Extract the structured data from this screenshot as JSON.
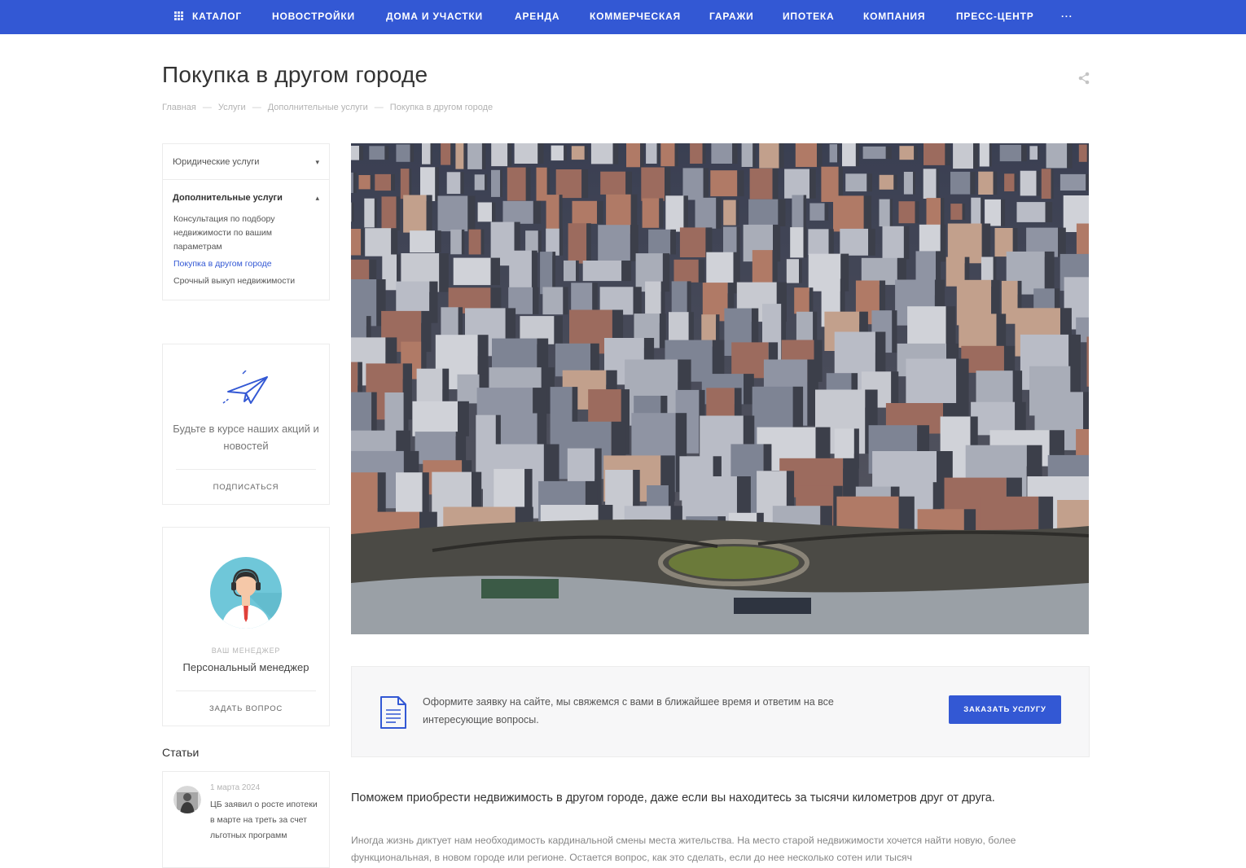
{
  "nav": {
    "items": [
      "КАТАЛОГ",
      "НОВОСТРОЙКИ",
      "ДОМА И УЧАСТКИ",
      "АРЕНДА",
      "КОММЕРЧЕСКАЯ",
      "ГАРАЖИ",
      "ИПОТЕКА",
      "КОМПАНИЯ",
      "ПРЕСС-ЦЕНТР",
      "···"
    ],
    "catalog_icon": "grid-icon"
  },
  "page": {
    "title": "Покупка в другом городе",
    "share_icon": "share-icon"
  },
  "breadcrumb": [
    "Главная",
    "Услуги",
    "Дополнительные услуги",
    "Покупка в другом городе"
  ],
  "breadcrumb_sep": "—",
  "sidebar": {
    "legal": {
      "label": "Юридические услуги",
      "caret": "▾"
    },
    "extra": {
      "label": "Дополнительные услуги",
      "caret": "▴",
      "items": [
        "Консультация по подбору недвижимости по вашим параметрам",
        "Покупка в другом городе",
        "Срочный выкуп недвижимости"
      ],
      "active_index": 1
    }
  },
  "subscribe": {
    "icon": "paper-plane-icon",
    "text": "Будьте в курсе наших акций и новостей",
    "link": "ПОДПИСАТЬСЯ"
  },
  "manager": {
    "icon": "manager-avatar",
    "caption": "ВАШ МЕНЕДЖЕР",
    "name": "Персональный менеджер",
    "link": "ЗАДАТЬ ВОПРОС"
  },
  "articles": {
    "title": "Статьи",
    "items": [
      {
        "date": "1 марта 2024",
        "title": "ЦБ заявил о росте ипотеки в марте на треть за счет льготных программ"
      }
    ]
  },
  "cta": {
    "icon": "document-icon",
    "text": "Оформите заявку на сайте, мы свяжемся с вами в ближайшее время и ответим на все интересующие вопросы.",
    "button": "ЗАКАЗАТЬ УСЛУГУ"
  },
  "content": {
    "lead": "Поможем приобрести недвижимость в другом городе, даже если вы находитесь за тысячи километров друг от друга.",
    "body": "Иногда жизнь диктует нам необходимость кардинальной смены места жительства. На место старой недвижимости хочется найти новую, более функциональная, в новом городе или регионе. Остается вопрос, как это сделать, если до нее несколько сотен или тысяч"
  },
  "colors": {
    "brand": "#3358d4",
    "active_link": "#3358d4",
    "muted": "#b5b5b5"
  }
}
